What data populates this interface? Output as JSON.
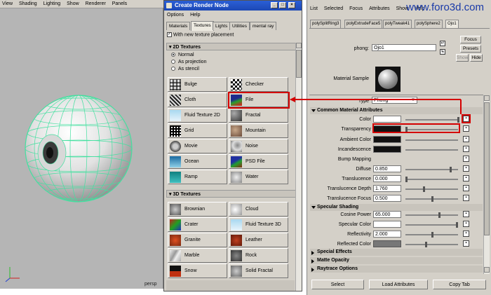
{
  "viewport": {
    "menu": [
      "View",
      "Shading",
      "Lighting",
      "Show",
      "Renderer",
      "Panels"
    ],
    "camera_label": "persp"
  },
  "render_node": {
    "title": "Create Render Node",
    "menu": [
      "Options",
      "Help"
    ],
    "tabs": [
      "Materials",
      "Textures",
      "Lights",
      "Utilities",
      "mental ray"
    ],
    "active_tab": "Textures",
    "checkbox_label": "With new texture placement",
    "section_2d": "2D Textures",
    "radios": [
      "Normal",
      "As projection",
      "As stencil"
    ],
    "nodes_2d": [
      [
        "Bulge",
        "Checker"
      ],
      [
        "Cloth",
        "File"
      ],
      [
        "Fluid Texture 2D",
        "Fractal"
      ],
      [
        "Grid",
        "Mountain"
      ],
      [
        "Movie",
        "Noise"
      ],
      [
        "Ocean",
        "PSD File"
      ],
      [
        "Ramp",
        "Water"
      ]
    ],
    "section_3d": "3D Textures",
    "nodes_3d": [
      [
        "Brownian",
        "Cloud"
      ],
      [
        "Crater",
        "Fluid Texture 3D"
      ],
      [
        "Granite",
        "Leather"
      ],
      [
        "Marble",
        "Rock"
      ],
      [
        "Snow",
        "Solid Fractal"
      ]
    ]
  },
  "attr_editor": {
    "menu": [
      "List",
      "Selected",
      "Focus",
      "Attributes",
      "Show",
      "Help"
    ],
    "tabs": [
      "polySplitRing3",
      "polyExtrudeFace5",
      "polyTweak41",
      "polySphere2",
      "Ojo1"
    ],
    "active_tab": "Ojo1",
    "node_type": "phong:",
    "node_name": "Ojo1",
    "side_buttons": [
      "Focus",
      "Presets",
      "Show",
      "Hide"
    ],
    "material_sample_label": "Material Sample",
    "type_label": "Type",
    "type_value": "Phong",
    "section_common": "Common Material Attributes",
    "common_attrs": [
      {
        "label": "Color",
        "value": ""
      },
      {
        "label": "Transparency",
        "value": ""
      },
      {
        "label": "Ambient Color",
        "value": ""
      },
      {
        "label": "Incandescence",
        "value": ""
      },
      {
        "label": "Bump Mapping",
        "value": ""
      },
      {
        "label": "Diffuse",
        "value": "0.850"
      },
      {
        "label": "Translucence",
        "value": "0.000"
      },
      {
        "label": "Translucence Depth",
        "value": "1.760"
      },
      {
        "label": "Translucence Focus",
        "value": "0.500"
      }
    ],
    "section_specular": "Specular Shading",
    "specular_attrs": [
      {
        "label": "Cosine Power",
        "value": "65.000"
      },
      {
        "label": "Specular Color",
        "value": ""
      },
      {
        "label": "Reflectivity",
        "value": "2.000"
      },
      {
        "label": "Reflected Color",
        "value": ""
      }
    ],
    "collapsed_sections": [
      "Special Effects",
      "Matte Opacity",
      "Raytrace Options"
    ],
    "bottom_buttons": [
      "Select",
      "Load Attributes",
      "Copy Tab"
    ]
  },
  "watermark": "www.foro3d.com",
  "colors": {
    "highlight": "#d40000",
    "wireframe": "#44e0a0",
    "titlebar": "#1d48b5"
  }
}
